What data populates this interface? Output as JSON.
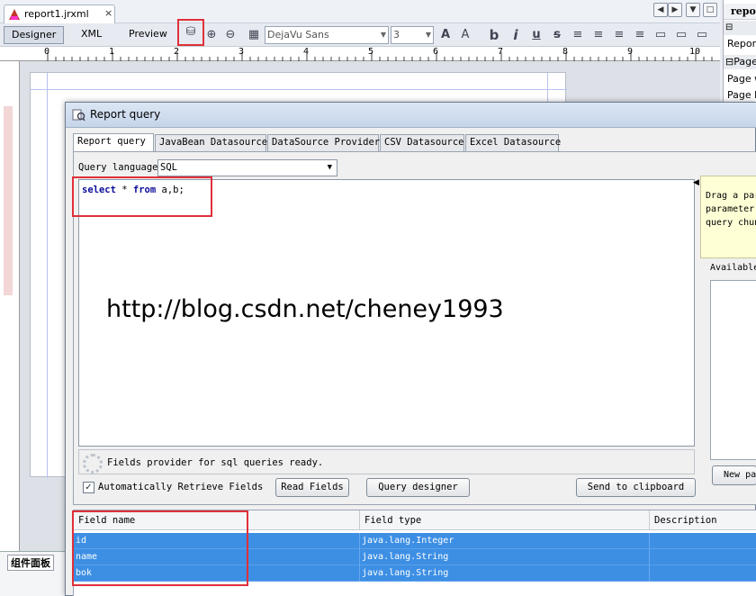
{
  "document_tab": {
    "label": "report1.jrxml",
    "close": "×"
  },
  "view_tabs": [
    "Designer",
    "XML",
    "Preview"
  ],
  "font_name": "DejaVu Sans",
  "font_size": "3",
  "ruler_numbers": [
    "0",
    "1",
    "2",
    "3",
    "4",
    "5",
    "6",
    "7",
    "8",
    "9",
    "10"
  ],
  "right_panel": {
    "header": "repo",
    "rows": [
      "Report",
      "Page",
      "Page w",
      "Page h"
    ]
  },
  "bottom_panel": {
    "title": "组件面板"
  },
  "dialog": {
    "title": "Report query",
    "tabs": [
      "Report query",
      "JavaBean Datasource",
      "DataSource Provider",
      "CSV Datasource",
      "Excel Datasource"
    ],
    "query_language_label": "Query language",
    "query_language_value": "SQL",
    "sql": {
      "kw1": "select",
      "star": " * ",
      "kw2": "from",
      "rest": " a,b;"
    },
    "watermark": "http://blog.csdn.net/cheney1993",
    "status": "Fields provider for sql queries ready.",
    "auto_retrieve_label": "Automatically Retrieve Fields",
    "auto_retrieve_checked": true,
    "buttons": {
      "read_fields": "Read Fields",
      "query_designer": "Query designer",
      "send_clipboard": "Send to clipboard"
    },
    "side_hint_lines": [
      "Drag a par",
      "parameter.",
      "query chun"
    ],
    "available_label": "Available",
    "new_param_label": "New pa",
    "fields_table": {
      "columns": [
        "Field name",
        "Field type",
        "Description"
      ],
      "rows": [
        {
          "name": "id",
          "type": "java.lang.Integer",
          "description": ""
        },
        {
          "name": "name",
          "type": "java.lang.String",
          "description": ""
        },
        {
          "name": "bok",
          "type": "java.lang.String",
          "description": ""
        }
      ]
    }
  },
  "colors": {
    "highlight_box": "#e0303a",
    "selection": "#3d8fe4",
    "keyword": "#0b0b9a",
    "hint_bg": "#ffffd6"
  }
}
